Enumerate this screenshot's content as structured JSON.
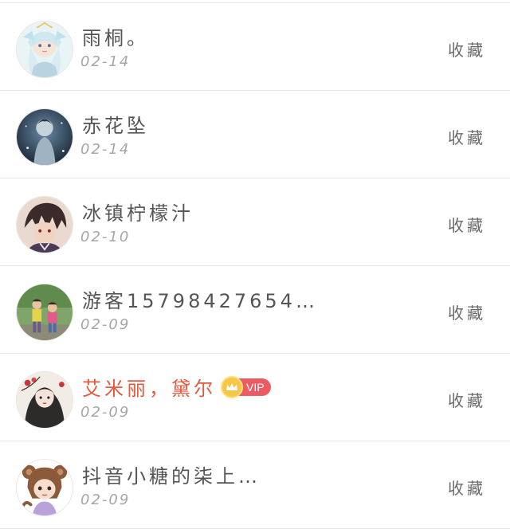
{
  "items": [
    {
      "name": "雨桐。",
      "date": "02-14",
      "action": "收藏",
      "avatar": "anime-girl-avatar",
      "vip": false
    },
    {
      "name": "赤花坠",
      "date": "02-14",
      "action": "收藏",
      "avatar": "dark-figure-avatar",
      "vip": false
    },
    {
      "name": "冰镇柠檬汁",
      "date": "02-10",
      "action": "收藏",
      "avatar": "anime-boy-avatar",
      "vip": false
    },
    {
      "name": "游客15798427654…",
      "date": "02-09",
      "action": "收藏",
      "avatar": "children-photo-avatar",
      "vip": false
    },
    {
      "name": "艾米丽，黛尔",
      "date": "02-09",
      "action": "收藏",
      "avatar": "ink-art-avatar",
      "vip": true,
      "vip_label": "VIP"
    },
    {
      "name": "抖音小糖的柒上…",
      "date": "02-09",
      "action": "收藏",
      "avatar": "bear-girl-avatar",
      "vip": false
    }
  ],
  "colors": {
    "name": "#555555",
    "vip_name": "#e35a3f",
    "date": "#a6a6a6",
    "action": "#6a6a6a",
    "divider": "#e6e6e6",
    "vip_badge": "#ec5a62",
    "crown": "#f6c646"
  }
}
